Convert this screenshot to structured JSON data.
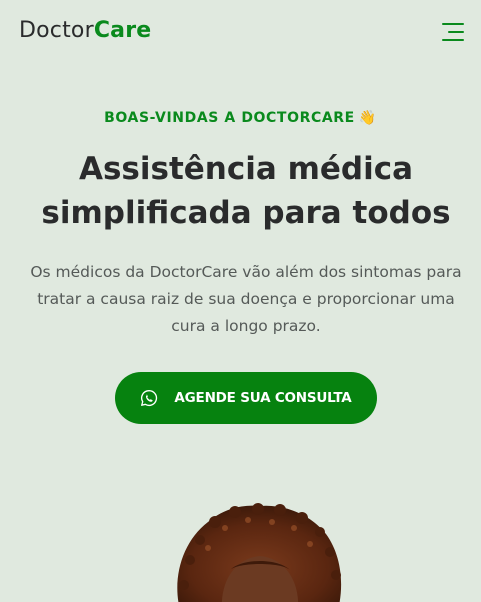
{
  "header": {
    "logo_part1": "Doctor",
    "logo_part2": "Care",
    "menu_icon": "hamburger-menu-icon"
  },
  "hero": {
    "eyebrow": "BOAS-VINDAS A DOCTORCARE",
    "eyebrow_emoji": "👋",
    "title_line1": "Assistência médica",
    "title_line2": "simplificada para todos",
    "description": "Os médicos da DoctorCare vão além dos sintomas para tratar a causa raiz de sua doença e proporcionar uma cura a longo prazo.",
    "cta_label": "AGENDE SUA CONSULTA",
    "cta_icon": "whatsapp-icon"
  },
  "colors": {
    "background": "#e0e9df",
    "brand_green": "#0a8a1d",
    "button_green": "#06820f",
    "text_dark": "#2a2b2c",
    "text_muted": "#555a58"
  }
}
